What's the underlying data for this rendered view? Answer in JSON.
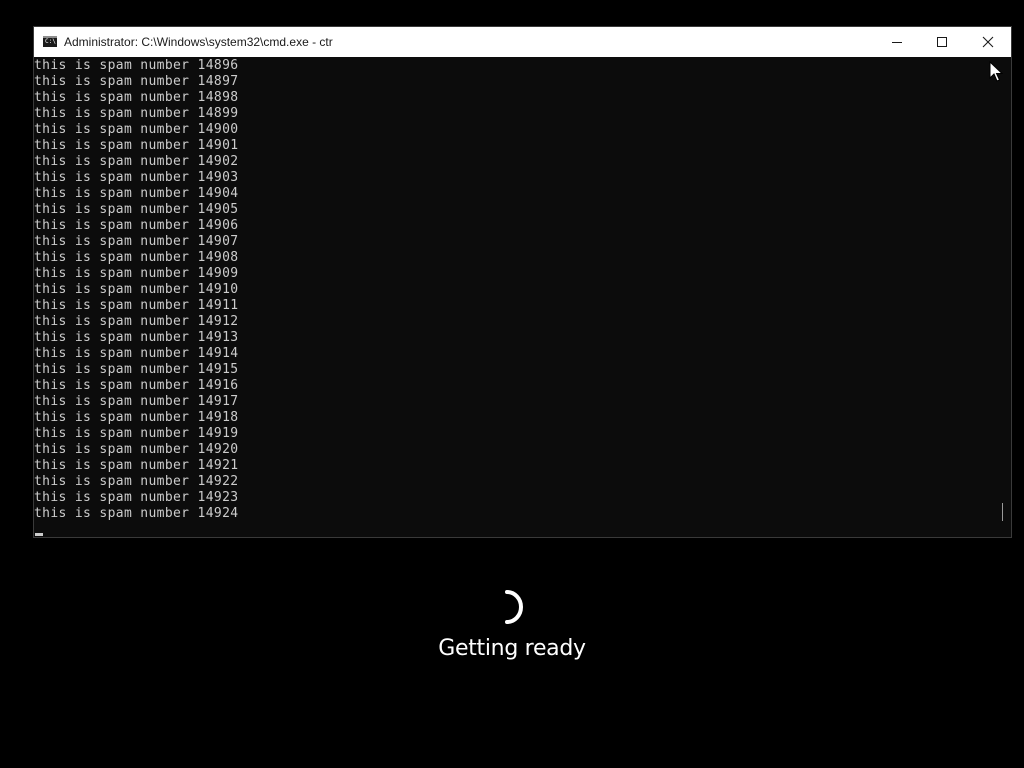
{
  "window": {
    "title": "Administrator: C:\\Windows\\system32\\cmd.exe - ctr",
    "icon": "cmd-icon",
    "buttons": {
      "minimize": "minimize-icon",
      "maximize": "maximize-icon",
      "close": "close-icon"
    }
  },
  "console": {
    "text_color": "#cccccc",
    "background": "#0c0c0c",
    "lines": [
      "this is spam number 14896",
      "this is spam number 14897",
      "this is spam number 14898",
      "this is spam number 14899",
      "this is spam number 14900",
      "this is spam number 14901",
      "this is spam number 14902",
      "this is spam number 14903",
      "this is spam number 14904",
      "this is spam number 14905",
      "this is spam number 14906",
      "this is spam number 14907",
      "this is spam number 14908",
      "this is spam number 14909",
      "this is spam number 14910",
      "this is spam number 14911",
      "this is spam number 14912",
      "this is spam number 14913",
      "this is spam number 14914",
      "this is spam number 14915",
      "this is spam number 14916",
      "this is spam number 14917",
      "this is spam number 14918",
      "this is spam number 14919",
      "this is spam number 14920",
      "this is spam number 14921",
      "this is spam number 14922",
      "this is spam number 14923",
      "this is spam number 14924"
    ]
  },
  "overlay": {
    "status": "Getting ready",
    "spinner": "loading-spinner-icon"
  },
  "cursor_icon": "mouse-pointer-icon"
}
